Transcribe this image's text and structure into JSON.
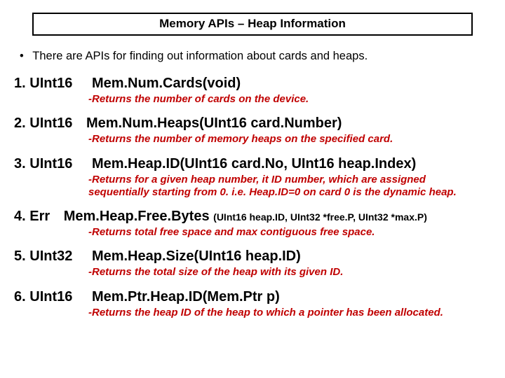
{
  "title": "Memory APIs – Heap Information",
  "bullet": "There are APIs for finding out information about cards and heaps.",
  "items": [
    {
      "num": "1.",
      "ret": "UInt16",
      "sig": "Mem.Num.Cards(void)",
      "desc": "-Returns the number of cards on the device."
    },
    {
      "num": "2.",
      "ret": "UInt16",
      "sig": "Mem.Num.Heaps(UInt16 card.Number)",
      "desc": "-Returns the number of memory heaps on the specified card."
    },
    {
      "num": "3.",
      "ret": "UInt16",
      "sig": "Mem.Heap.ID(UInt16 card.No, UInt16 heap.Index)",
      "desc": "-Returns for a given heap number, it ID number, which are assigned sequentially starting from 0. i.e. Heap.ID=0 on card 0 is the dynamic heap."
    },
    {
      "num": "4.",
      "ret": "Err",
      "sig": "Mem.Heap.Free.Bytes",
      "args": "(UInt16 heap.ID, UInt32 *free.P, UInt32 *max.P)",
      "desc": "-Returns total free space and max contiguous free space."
    },
    {
      "num": "5.",
      "ret": "UInt32",
      "sig": "Mem.Heap.Size(UInt16 heap.ID)",
      "desc": "-Returns the total size of the heap with its given ID."
    },
    {
      "num": "6.",
      "ret": "UInt16",
      "sig": "Mem.Ptr.Heap.ID(Mem.Ptr p)",
      "desc": "-Returns the heap ID of the heap to which a pointer has been allocated."
    }
  ]
}
